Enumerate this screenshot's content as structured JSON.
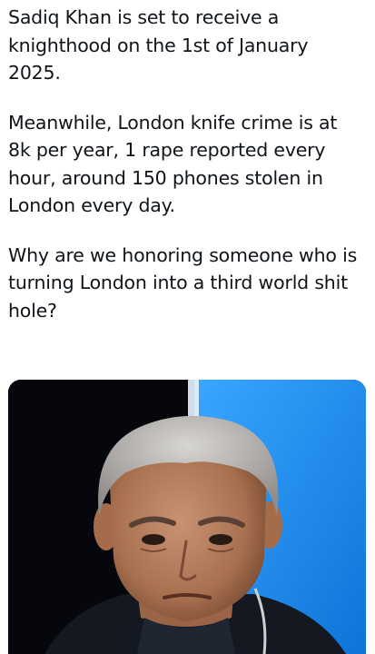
{
  "tweet": {
    "paragraphs": [
      "Sadiq Khan is set to receive a\nknighthood on the 1st of January\n2025.",
      "Meanwhile, London knife crime is at\n8k per year, 1 rape reported every\nhour, around 150 phones stolen in\nLondon every day.",
      "Why are we honoring someone who is\nturning London into a third world shit\nhole?"
    ]
  },
  "media": {
    "kind": "photo",
    "subject": "portrait-photo",
    "colors": {
      "left_background": "#05070c",
      "right_background": "#1e8ff0",
      "hair": "#b9b7b4",
      "skin": "#b88262",
      "suit": "#141820"
    }
  }
}
